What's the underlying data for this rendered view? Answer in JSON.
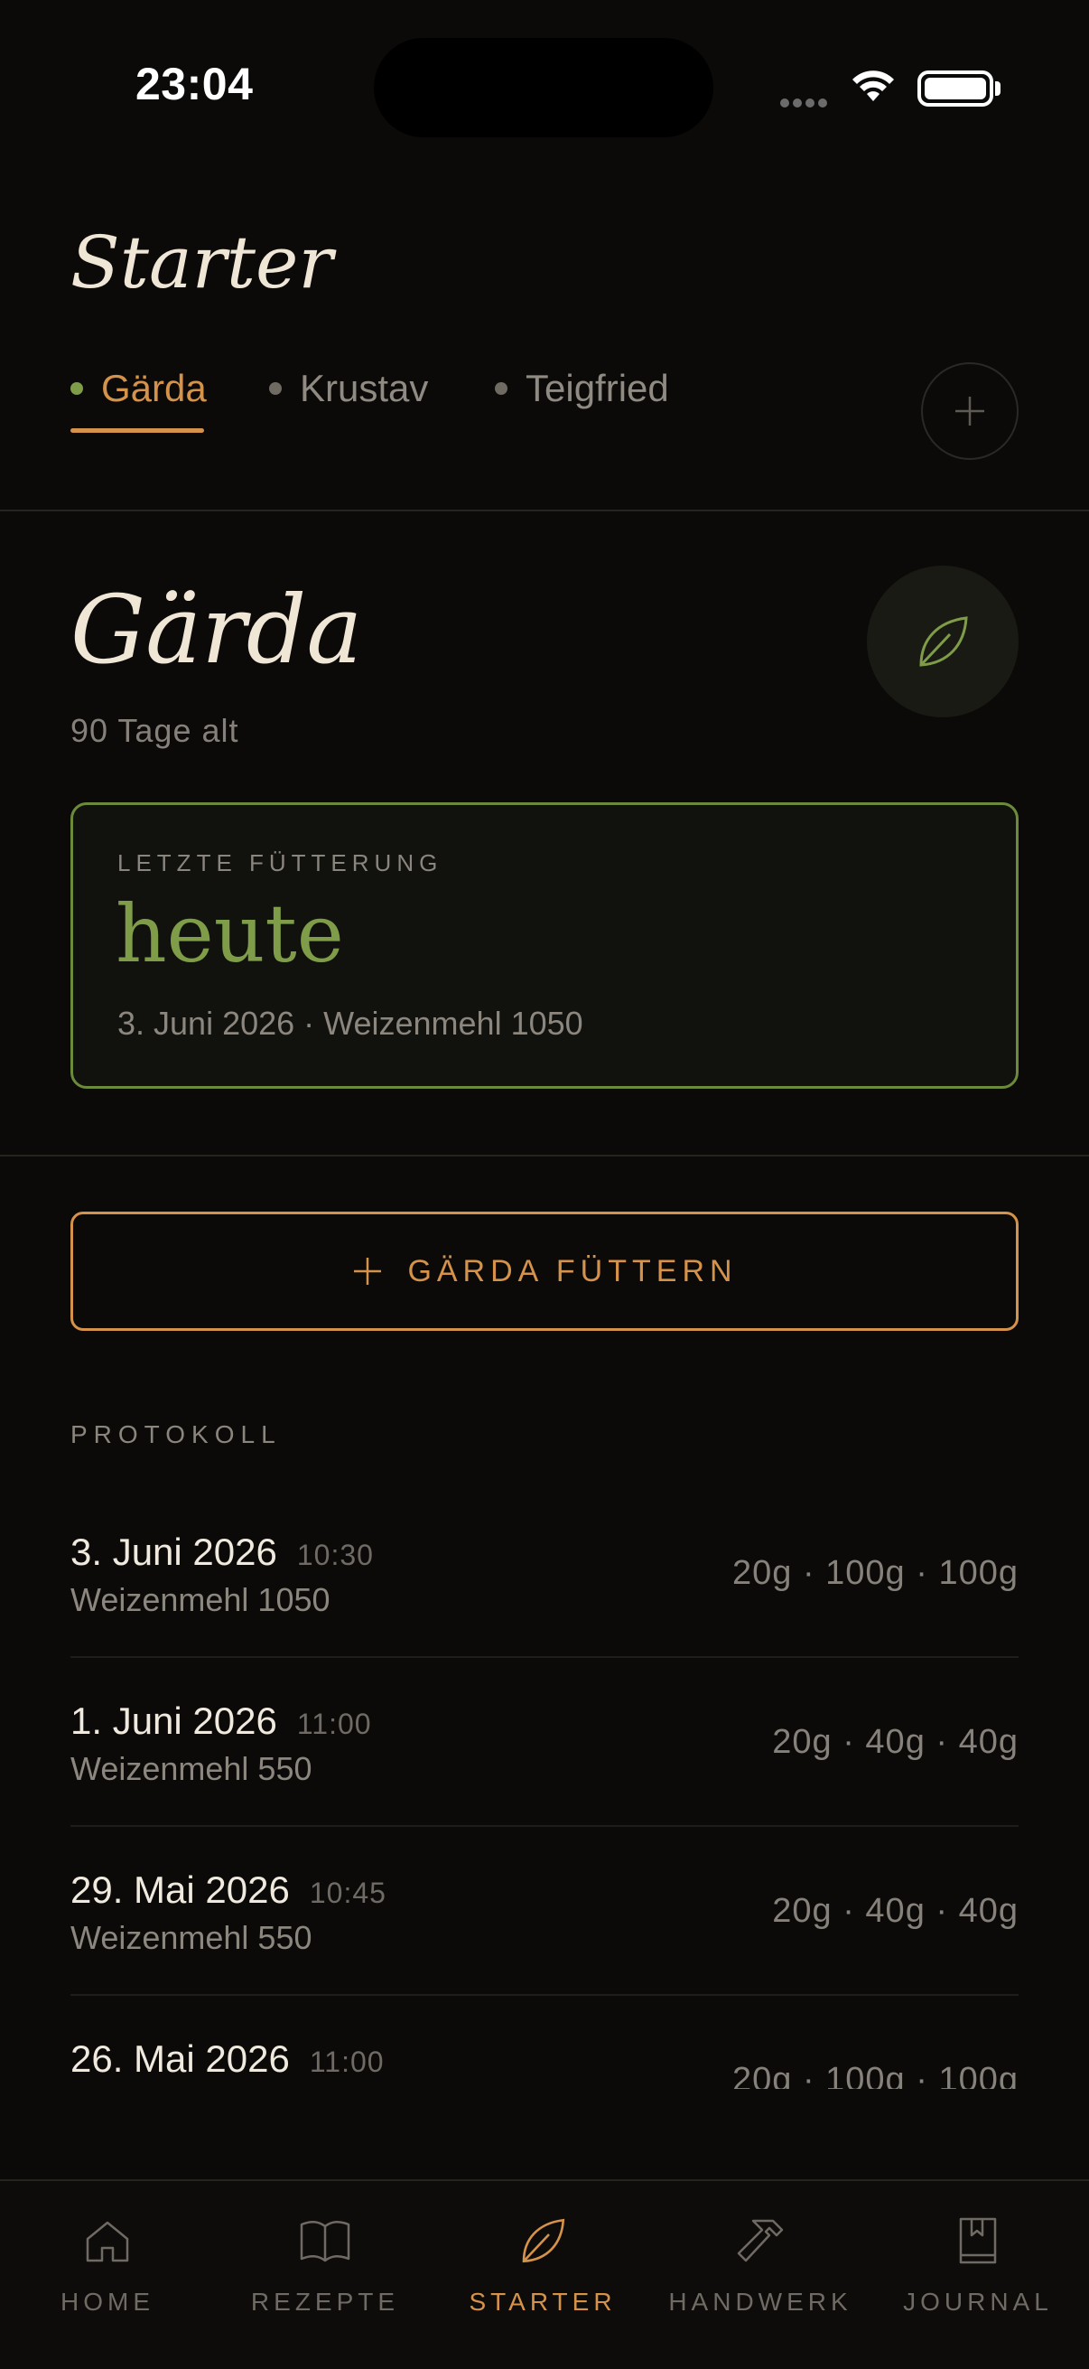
{
  "status_bar": {
    "time": "23:04"
  },
  "header": {
    "title": "Starter",
    "tabs": [
      {
        "label": "Gärda",
        "active": true
      },
      {
        "label": "Krustav",
        "active": false
      },
      {
        "label": "Teigfried",
        "active": false
      }
    ],
    "add_icon": "plus-icon"
  },
  "starter": {
    "name": "Gärda",
    "age": "90 Tage alt",
    "icon": "leaf-icon",
    "last_feeding": {
      "label": "LETZTE FÜTTERUNG",
      "value": "heute",
      "detail": "3. Juni 2026 · Weizenmehl 1050"
    }
  },
  "feed_button": {
    "label": "GÄRDA FÜTTERN",
    "icon": "plus-icon"
  },
  "log": {
    "label": "PROTOKOLL",
    "entries": [
      {
        "date": "3. Juni 2026",
        "time": "10:30",
        "flour": "Weizenmehl 1050",
        "amounts": "20g · 100g · 100g"
      },
      {
        "date": "1. Juni 2026",
        "time": "11:00",
        "flour": "Weizenmehl 550",
        "amounts": "20g · 40g · 40g"
      },
      {
        "date": "29. Mai 2026",
        "time": "10:45",
        "flour": "Weizenmehl 550",
        "amounts": "20g · 40g · 40g"
      },
      {
        "date": "26. Mai 2026",
        "time": "11:00",
        "flour": "",
        "amounts": "20g · 100g · 100g"
      }
    ]
  },
  "bottom_nav": {
    "items": [
      {
        "label": "HOME",
        "icon": "home-icon",
        "active": false
      },
      {
        "label": "REZEPTE",
        "icon": "book-icon",
        "active": false
      },
      {
        "label": "STARTER",
        "icon": "leaf-icon",
        "active": true
      },
      {
        "label": "HANDWERK",
        "icon": "hammer-icon",
        "active": false
      },
      {
        "label": "JOURNAL",
        "icon": "journal-icon",
        "active": false
      }
    ]
  },
  "colors": {
    "accent": "#d5924a",
    "green": "#7f9d49",
    "background": "#0b0a09"
  }
}
